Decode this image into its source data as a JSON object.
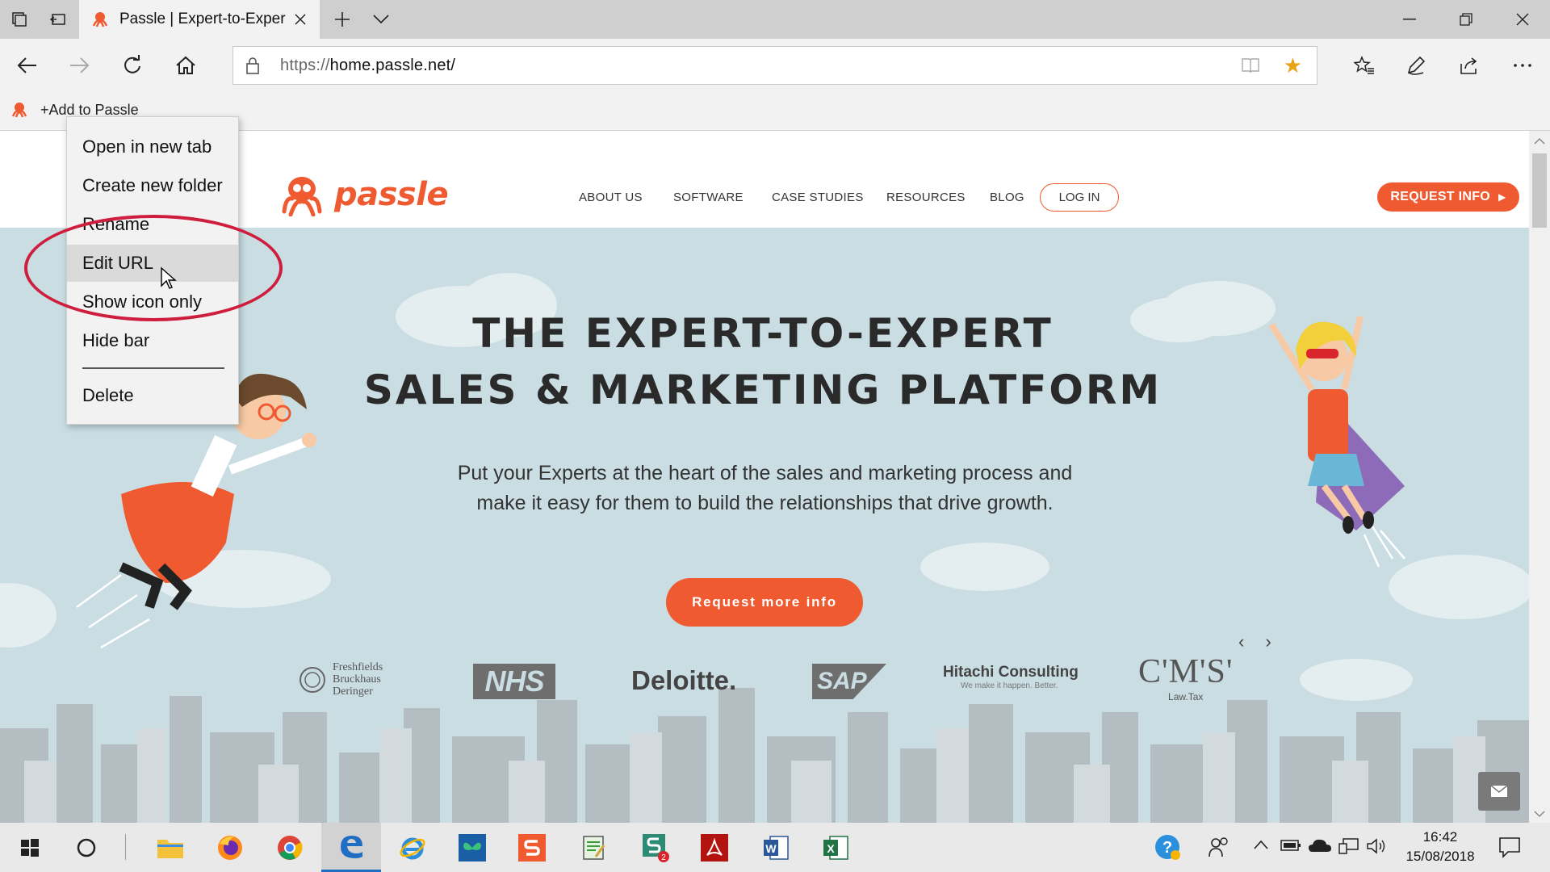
{
  "browser": {
    "tab_title": "Passle | Expert-to-Exper",
    "url_protocol": "https://",
    "url_host": "home.passle.net/",
    "favorites_bar": {
      "item_label": "+Add to Passle"
    }
  },
  "context_menu": {
    "items": [
      "Open in new tab",
      "Create new folder",
      "Rename",
      "Edit URL",
      "Show icon only",
      "Hide bar",
      "Delete"
    ],
    "hovered_item": "Edit URL"
  },
  "site": {
    "logo_text": "passle",
    "nav": [
      "ABOUT US",
      "SOFTWARE",
      "CASE STUDIES",
      "RESOURCES",
      "BLOG"
    ],
    "login_label": "LOG IN",
    "request_info_label": "REQUEST INFO",
    "hero_title_line1": "THE EXPERT-TO-EXPERT",
    "hero_title_line2": "SALES & MARKETING PLATFORM",
    "hero_subtitle": "Put your Experts at the heart of the sales and marketing process and make it easy for them to build the relationships that drive growth.",
    "cta_label": "Request more info",
    "carousel_arrows": "‹ ›",
    "clients": {
      "freshfields_1": "Freshfields",
      "freshfields_2": "Bruckhaus",
      "freshfields_3": "Deringer",
      "nhs": "NHS",
      "deloitte": "Deloitte.",
      "sap": "SAP",
      "hitachi": "Hitachi Consulting",
      "hitachi_tagline": "We make it happen. Better.",
      "cms": "C'M'S'",
      "cms_tagline": "Law.Tax"
    }
  },
  "taskbar": {
    "apps": [
      "start",
      "search",
      "file-explorer",
      "firefox",
      "chrome",
      "edge",
      "internet-explorer",
      "app-butterfly",
      "app-s",
      "app-notepad",
      "app-s-badge",
      "acrobat",
      "word",
      "excel"
    ],
    "badge_count": "2",
    "time": "16:42",
    "date": "15/08/2018"
  },
  "colors": {
    "brand_orange": "#ef5a30",
    "hero_bg": "#c9dde3",
    "highlight_red": "#cf1d3d",
    "favorite_star": "#e8a317"
  }
}
